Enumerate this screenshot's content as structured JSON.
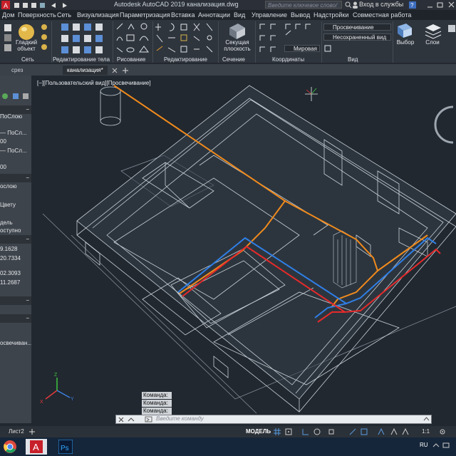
{
  "titlebar": {
    "title": "Autodesk AutoCAD 2019   канализация.dwg",
    "search_placeholder": "Введите ключевое слово/фразу",
    "login": "Вход в службы"
  },
  "menu": [
    "Дом",
    "Поверхность",
    "Сеть",
    "Визуализация",
    "Параметризация",
    "Вставка",
    "Аннотации",
    "Вид",
    "Управление",
    "Вывод",
    "Надстройки",
    "Совместная работа"
  ],
  "ribbon": {
    "smooth_object": "Гладкий объект",
    "section_plane": "Секущая плоскость",
    "xray_combo": "Просвечивание",
    "unsaved_view_combo": "Несохраненный вид",
    "world_combo": "Мировая",
    "selection": "Выбор",
    "layers": "Слои",
    "panels": {
      "network": "Сеть",
      "body_edit": "Редактирование тела",
      "draw": "Рисование",
      "modify": "Редактирование",
      "section": "Сечение",
      "coordinates": "Координаты",
      "view": "Вид"
    }
  },
  "tabs": {
    "tab1": "срез",
    "tab2": "канализация*"
  },
  "viewport_label": "[−][Пользовательский вид][Просвечивание]",
  "properties": [
    "ПоСлою",
    "— ПоСл...",
    "00",
    "— ПоСл...",
    "00",
    "ослою",
    "Цвету",
    "дель",
    "оступно",
    "9.1628",
    "20.7334",
    "02.3093",
    "11.2687",
    "освечиван..."
  ],
  "command": {
    "history": [
      "Команда:",
      "Команда:",
      "Команда:"
    ],
    "placeholder": "Введите команду"
  },
  "statusbar": {
    "layout_tab": "Лист2",
    "model": "МОДЕЛЬ",
    "scale": "1:1"
  },
  "taskbar": {
    "lang": "RU"
  },
  "colors": {
    "pipe_orange": "#f08a1c",
    "pipe_blue": "#2f7fe6",
    "pipe_red": "#e52a2a",
    "wall_edges": "#c9cfd6"
  }
}
